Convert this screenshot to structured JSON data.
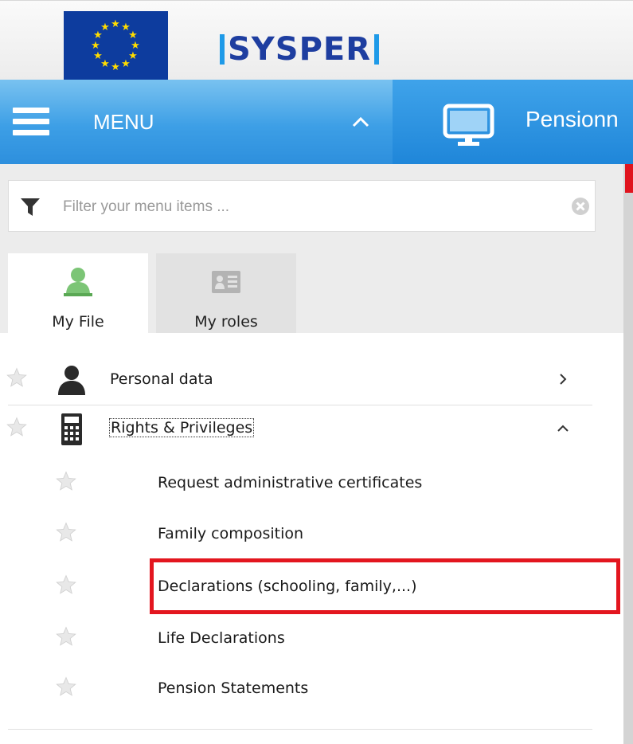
{
  "header": {
    "logo_text": "SYSPER",
    "flag_icon": "eu-flag-icon"
  },
  "menubar": {
    "menu_label": "MENU",
    "app_title": "Pensionn"
  },
  "filter": {
    "placeholder": "Filter your menu items ..."
  },
  "tabs": [
    {
      "label": "My File",
      "icon": "user-icon"
    },
    {
      "label": "My roles",
      "icon": "id-card-icon"
    }
  ],
  "menu": {
    "items": [
      {
        "label": "Personal data",
        "icon": "person-icon",
        "state": "collapsed"
      },
      {
        "label": "Rights & Privileges",
        "icon": "calculator-icon",
        "state": "expanded"
      }
    ],
    "subitems": [
      {
        "label": "Request administrative certificates"
      },
      {
        "label": "Family composition"
      },
      {
        "label": "Declarations (schooling, family,...)"
      },
      {
        "label": "Life Declarations"
      },
      {
        "label": "Pension Statements"
      }
    ]
  },
  "colors": {
    "menubar_blue": "#3d9fe6",
    "highlight_red": "#e3161f",
    "logo_blue": "#1e3ea0"
  }
}
